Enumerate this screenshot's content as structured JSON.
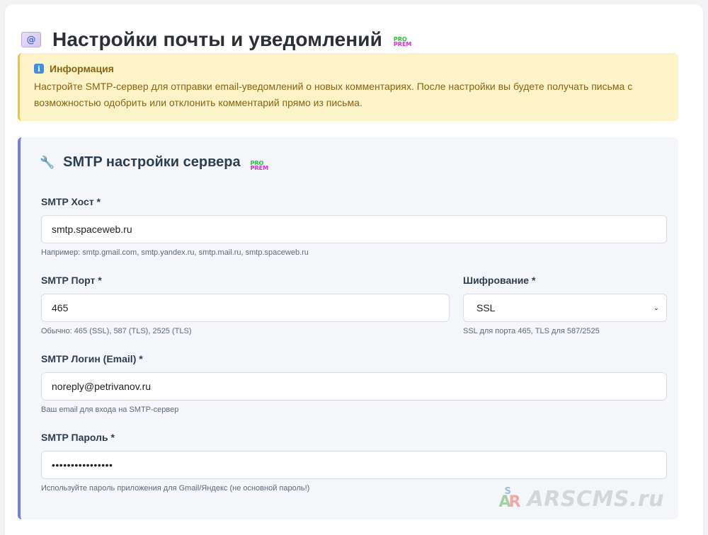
{
  "page": {
    "title": "Настройки почты и уведомлений",
    "mail_icon": "@",
    "badge": {
      "line1": "PRO",
      "line2": "PREM"
    }
  },
  "info": {
    "icon": "i",
    "title": "Информация",
    "text": "Настройте SMTP-сервер для отправки email-уведомлений о новых комментариях. После настройки вы будете получать письма с возможностью одобрить или отклонить комментарий прямо из письма."
  },
  "smtp": {
    "section_title": "SMTP настройки сервера",
    "badge": {
      "line1": "PRO",
      "line2": "PREM"
    },
    "host": {
      "label": "SMTP Хост *",
      "value": "smtp.spaceweb.ru",
      "hint": "Например: smtp.gmail.com, smtp.yandex.ru, smtp.mail.ru, smtp.spaceweb.ru"
    },
    "port": {
      "label": "SMTP Порт *",
      "value": "465",
      "hint": "Обычно: 465 (SSL), 587 (TLS), 2525 (TLS)"
    },
    "encryption": {
      "label": "Шифрование *",
      "selected": "SSL",
      "hint": "SSL для порта 465, TLS для 587/2525"
    },
    "login": {
      "label": "SMTP Логин (Email) *",
      "value": "noreply@petrivanov.ru",
      "hint": "Ваш email для входа на SMTP-сервер"
    },
    "password": {
      "label": "SMTP Пароль *",
      "value": "••••••••••••••••",
      "hint": "Используйте пароль приложения для Gmail/Яндекс (не основной пароль!)"
    }
  },
  "watermark": {
    "text": "ARSCMS.ru",
    "logo_a": "A",
    "logo_r": "R",
    "logo_s": "S"
  },
  "colors": {
    "info_bg": "#fdf3c8",
    "info_border": "#f1c232",
    "section_accent": "#6f7fe0",
    "pro": "#1fc43a",
    "prem": "#d62fd6"
  }
}
